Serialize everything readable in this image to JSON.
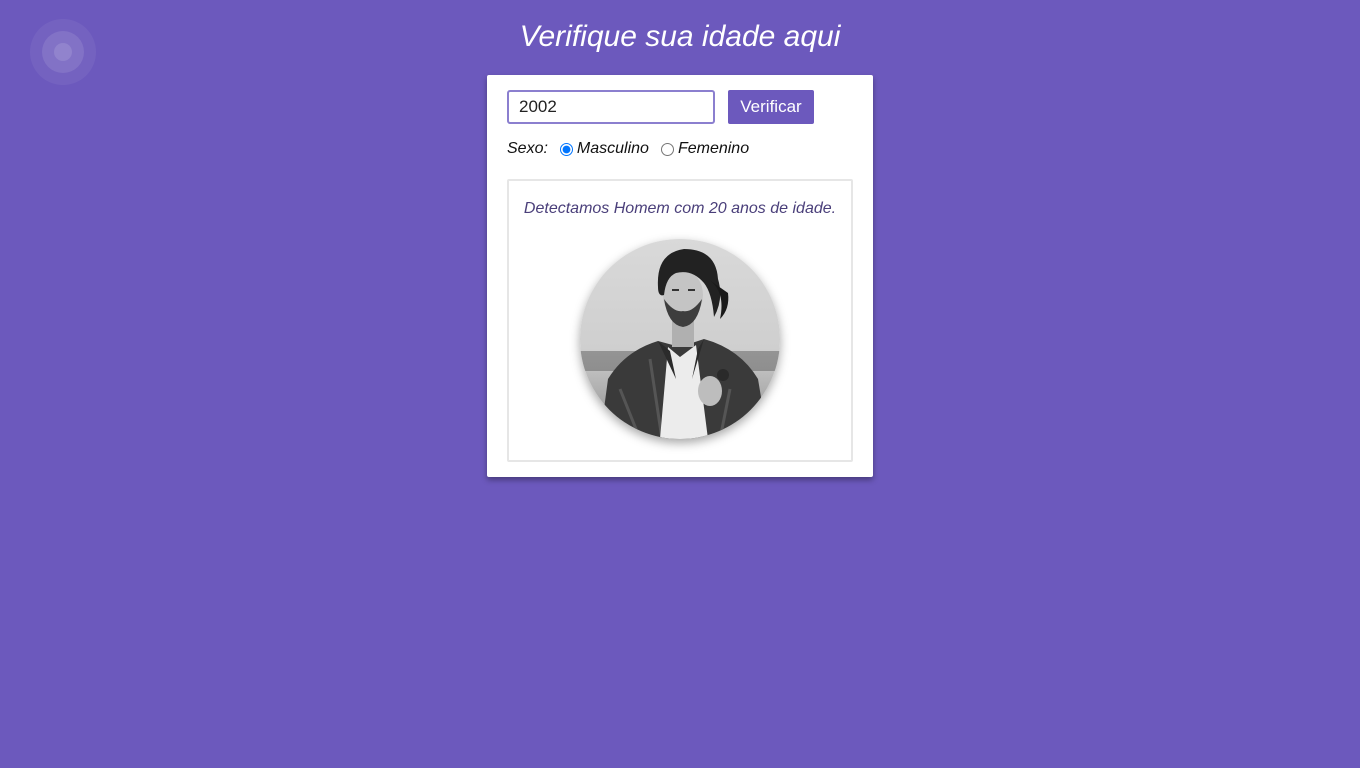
{
  "page": {
    "title": "Verifique sua idade aqui"
  },
  "form": {
    "year_value": "2002",
    "verify_label": "Verificar",
    "sex_label": "Sexo:",
    "options": [
      {
        "label": "Masculino",
        "checked": true
      },
      {
        "label": "Femenino",
        "checked": false
      }
    ]
  },
  "result": {
    "text": "Detectamos Homem com 20 anos de idade.",
    "image_icon": "man-portrait-photo"
  },
  "colors": {
    "background": "#6c59bd",
    "accent": "#6c59bd",
    "card": "#ffffff"
  }
}
